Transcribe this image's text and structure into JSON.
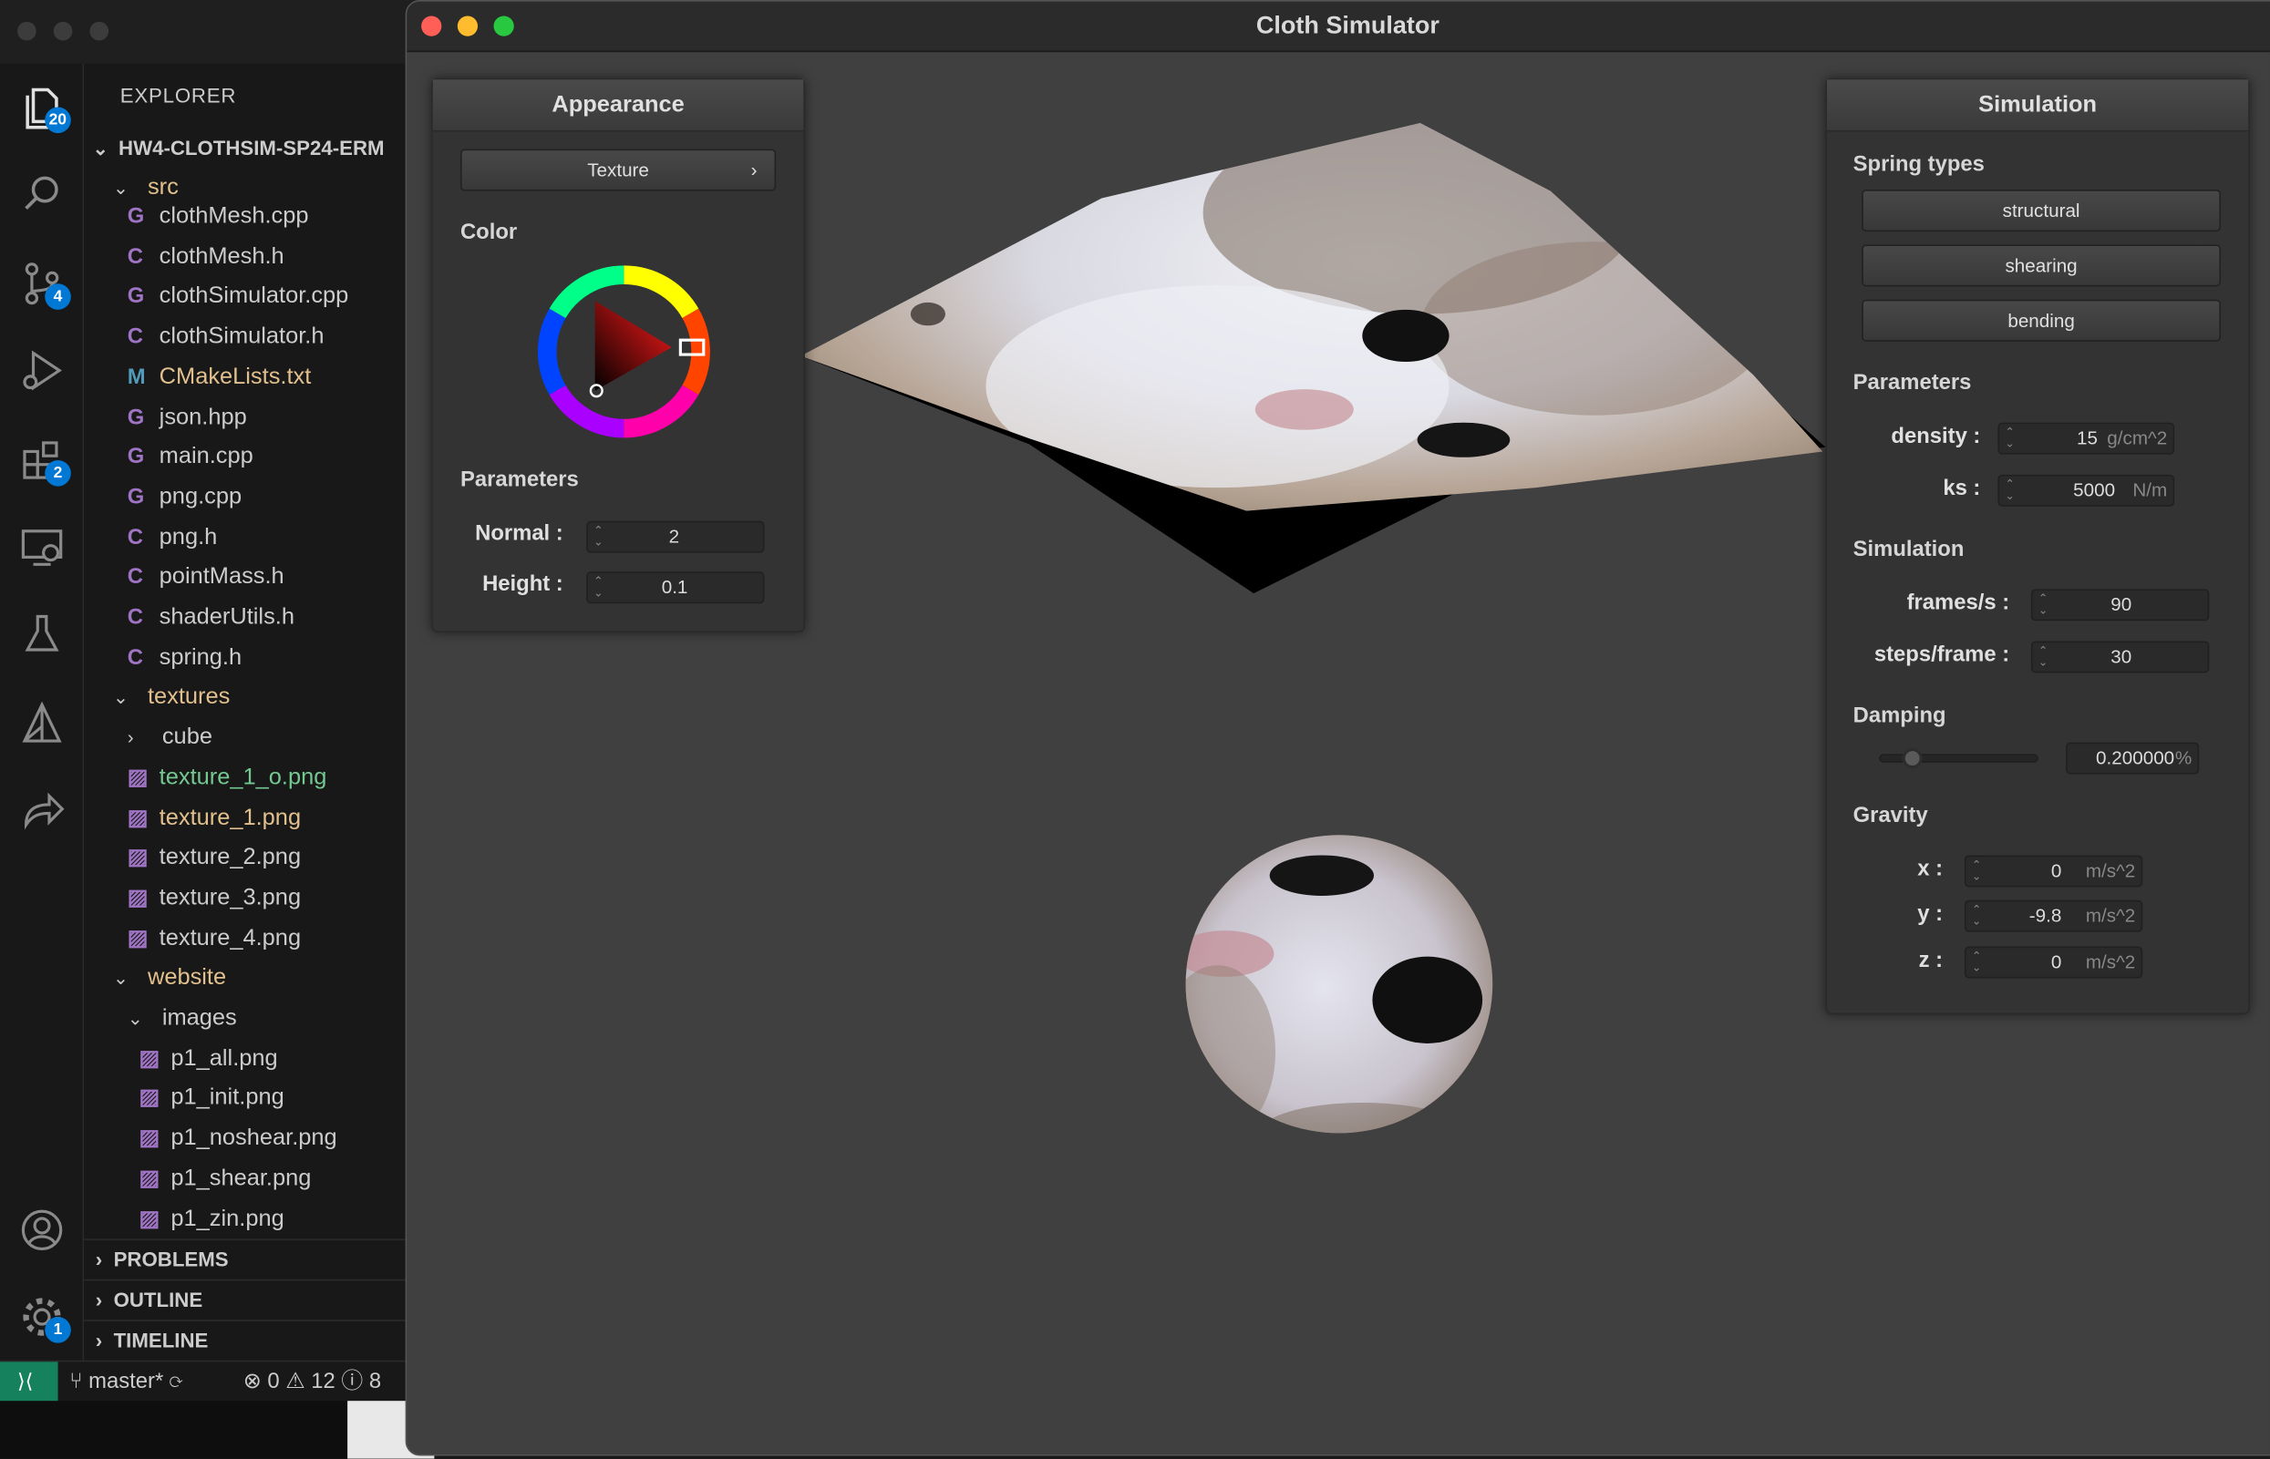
{
  "vscode": {
    "explorer_title": "EXPLORER",
    "project": "HW4-CLOTHSIM-SP24-ERM",
    "activity_badges": {
      "explorer": "20",
      "scm": "4",
      "extensions": "2",
      "settings": "1"
    },
    "tree": [
      {
        "label": "src",
        "kind": "folder-open",
        "color": "#e2c08d"
      },
      {
        "label": "clothMesh.cpp",
        "kind": "cpp",
        "color": "#cccccc"
      },
      {
        "label": "clothMesh.h",
        "kind": "h",
        "color": "#cccccc"
      },
      {
        "label": "clothSimulator.cpp",
        "kind": "cpp",
        "color": "#cccccc"
      },
      {
        "label": "clothSimulator.h",
        "kind": "h",
        "color": "#cccccc"
      },
      {
        "label": "CMakeLists.txt",
        "kind": "cmake",
        "color": "#e2c08d"
      },
      {
        "label": "json.hpp",
        "kind": "cpp",
        "color": "#cccccc"
      },
      {
        "label": "main.cpp",
        "kind": "cpp",
        "color": "#cccccc"
      },
      {
        "label": "png.cpp",
        "kind": "cpp",
        "color": "#cccccc"
      },
      {
        "label": "png.h",
        "kind": "h",
        "color": "#cccccc"
      },
      {
        "label": "pointMass.h",
        "kind": "h",
        "color": "#cccccc"
      },
      {
        "label": "shaderUtils.h",
        "kind": "h",
        "color": "#cccccc"
      },
      {
        "label": "spring.h",
        "kind": "h",
        "color": "#cccccc"
      },
      {
        "label": "textures",
        "kind": "folder-open",
        "color": "#e2c08d"
      },
      {
        "label": "cube",
        "kind": "folder-closed",
        "color": "#cccccc"
      },
      {
        "label": "texture_1_o.png",
        "kind": "img",
        "color": "#73c991"
      },
      {
        "label": "texture_1.png",
        "kind": "img",
        "color": "#e2c08d"
      },
      {
        "label": "texture_2.png",
        "kind": "img",
        "color": "#cccccc"
      },
      {
        "label": "texture_3.png",
        "kind": "img",
        "color": "#cccccc"
      },
      {
        "label": "texture_4.png",
        "kind": "img",
        "color": "#cccccc"
      },
      {
        "label": "website",
        "kind": "folder-open",
        "color": "#e2c08d"
      },
      {
        "label": "images",
        "kind": "folder-open",
        "color": "#cccccc"
      },
      {
        "label": "p1_all.png",
        "kind": "img",
        "color": "#cccccc"
      },
      {
        "label": "p1_init.png",
        "kind": "img",
        "color": "#cccccc"
      },
      {
        "label": "p1_noshear.png",
        "kind": "img",
        "color": "#cccccc"
      },
      {
        "label": "p1_shear.png",
        "kind": "img",
        "color": "#cccccc"
      },
      {
        "label": "p1_zin.png",
        "kind": "img",
        "color": "#cccccc"
      }
    ],
    "sections": [
      "PROBLEMS",
      "OUTLINE",
      "TIMELINE"
    ],
    "status": {
      "branch": "master*",
      "errors": "0",
      "warnings": "12",
      "info": "8"
    }
  },
  "sim": {
    "title": "Cloth Simulator",
    "appearance": {
      "title": "Appearance",
      "texture_button": "Texture",
      "texture_arrow": "›",
      "color_label": "Color",
      "params_label": "Parameters",
      "normal_label": "Normal :",
      "normal_value": "2",
      "height_label": "Height :",
      "height_value": "0.1"
    },
    "simulation": {
      "title": "Simulation",
      "spring_types_label": "Spring types",
      "structural": "structural",
      "shearing": "shearing",
      "bending": "bending",
      "params_label": "Parameters",
      "density_label": "density :",
      "density_value": "15",
      "density_unit": "g/cm^2",
      "ks_label": "ks :",
      "ks_value": "5000",
      "ks_unit": "N/m",
      "sim_label": "Simulation",
      "fps_label": "frames/s :",
      "fps_value": "90",
      "steps_label": "steps/frame :",
      "steps_value": "30",
      "damping_label": "Damping",
      "damping_value": "0.200000",
      "damping_unit": "%",
      "damping_slider": 0.2,
      "gravity_label": "Gravity",
      "gx_label": "x :",
      "gx_value": "0",
      "gy_label": "y :",
      "gy_value": "-9.8",
      "gz_label": "z :",
      "gz_value": "0",
      "g_unit": "m/s^2"
    }
  }
}
